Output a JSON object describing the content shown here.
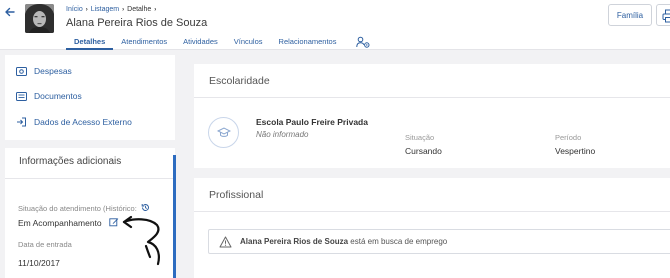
{
  "header": {
    "breadcrumb": [
      {
        "label": "Início",
        "sep": "›"
      },
      {
        "label": "Listagem",
        "sep": "›"
      },
      {
        "label": "Detalhe",
        "sep": "›"
      }
    ],
    "person_name": "Alana Pereira Rios de Souza",
    "tabs": [
      {
        "label": "Detalhes",
        "active": true
      },
      {
        "label": "Atendimentos",
        "active": false
      },
      {
        "label": "Atividades",
        "active": false
      },
      {
        "label": "Vínculos",
        "active": false
      },
      {
        "label": "Relacionamentos",
        "active": false
      }
    ],
    "tab_icon": "users-settings-icon",
    "family_button": "Família",
    "print_icon": "print-icon",
    "back_icon": "arrow-left-icon"
  },
  "sidebar": {
    "menu": [
      {
        "label": "Despesas",
        "icon": "money-icon"
      },
      {
        "label": "Documentos",
        "icon": "document-icon"
      },
      {
        "label": "Dados de Acesso Externo",
        "icon": "login-icon"
      }
    ],
    "info_title": "Informações adicionais",
    "status_label": "Situação do atendimento (Histórico:",
    "status_value": "Em Acompanhamento",
    "entry_label": "Data de entrada",
    "entry_value": "11/10/2017"
  },
  "escolaridade": {
    "title": "Escolaridade",
    "school_name": "Escola Paulo Freire Privada",
    "school_sub": "Não informado",
    "situacao_label": "Situação",
    "situacao_value": "Cursando",
    "periodo_label": "Período",
    "periodo_value": "Vespertino"
  },
  "profissional": {
    "title": "Profissional",
    "alert_name": "Alana Pereira Rios de Souza",
    "alert_text": "está em busca de emprego"
  },
  "colors": {
    "accent": "#2d5fa0",
    "rule": "#2d6cc0",
    "background": "#f2f2f4"
  }
}
